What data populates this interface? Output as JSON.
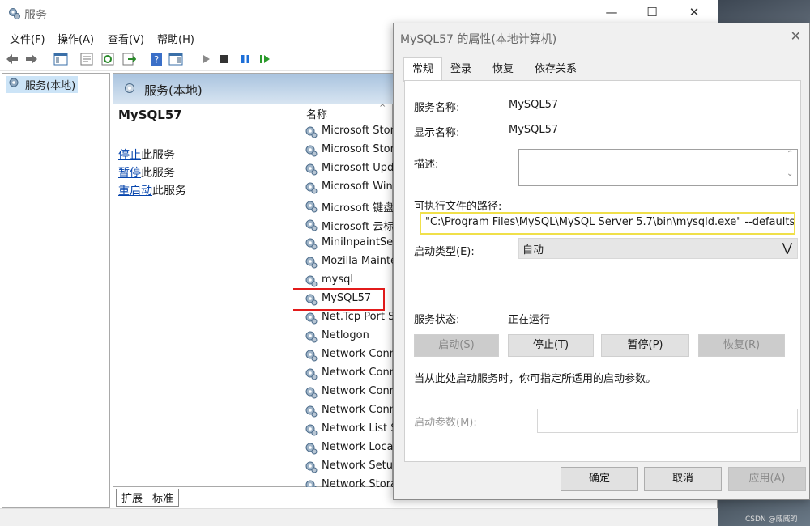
{
  "services_window": {
    "title": "服务",
    "menu": [
      "文件(F)",
      "操作(A)",
      "查看(V)",
      "帮助(H)"
    ],
    "tree_node": "服务(本地)",
    "pane_header": "服务(本地)",
    "selected_service": "MySQL57",
    "actions": [
      {
        "link": "停止",
        "rest": "此服务"
      },
      {
        "link": "暂停",
        "rest": "此服务"
      },
      {
        "link": "重启动",
        "rest": "此服务"
      }
    ],
    "list_column": "名称",
    "services": [
      "Microsoft Stora",
      "Microsoft Store",
      "Microsoft Upda",
      "Microsoft Wind",
      "Microsoft 键盘筛",
      "Microsoft 云标识",
      "MiniInpaintServ",
      "Mozilla Mainte",
      "mysql",
      "MySQL57",
      "Net.Tcp Port Sh",
      "Netlogon",
      "Network Conne",
      "Network Conne",
      "Network Conne",
      "Network Conne",
      "Network List Se",
      "Network Locati",
      "Network Setup",
      "Network Stora"
    ],
    "bottom_tabs": [
      "扩展",
      "标准"
    ]
  },
  "dialog": {
    "title": "MySQL57 的属性(本地计算机)",
    "tabs": [
      "常规",
      "登录",
      "恢复",
      "依存关系"
    ],
    "service_name_label": "服务名称:",
    "service_name": "MySQL57",
    "display_name_label": "显示名称:",
    "display_name": "MySQL57",
    "description_label": "描述:",
    "description": "",
    "path_label": "可执行文件的路径:",
    "path": "\"C:\\Program Files\\MySQL\\MySQL Server 5.7\\bin\\mysqld.exe\" --defaults-file='",
    "startup_type_label": "启动类型(E):",
    "startup_type": "自动",
    "status_label": "服务状态:",
    "status": "正在运行",
    "buttons": {
      "start": "启动(S)",
      "stop": "停止(T)",
      "pause": "暂停(P)",
      "resume": "恢复(R)"
    },
    "hint": "当从此处启动服务时，你可指定所适用的启动参数。",
    "params_label": "启动参数(M):",
    "params_value": "",
    "footer": {
      "ok": "确定",
      "cancel": "取消",
      "apply": "应用(A)"
    }
  },
  "watermark": "CSDN @威威的"
}
